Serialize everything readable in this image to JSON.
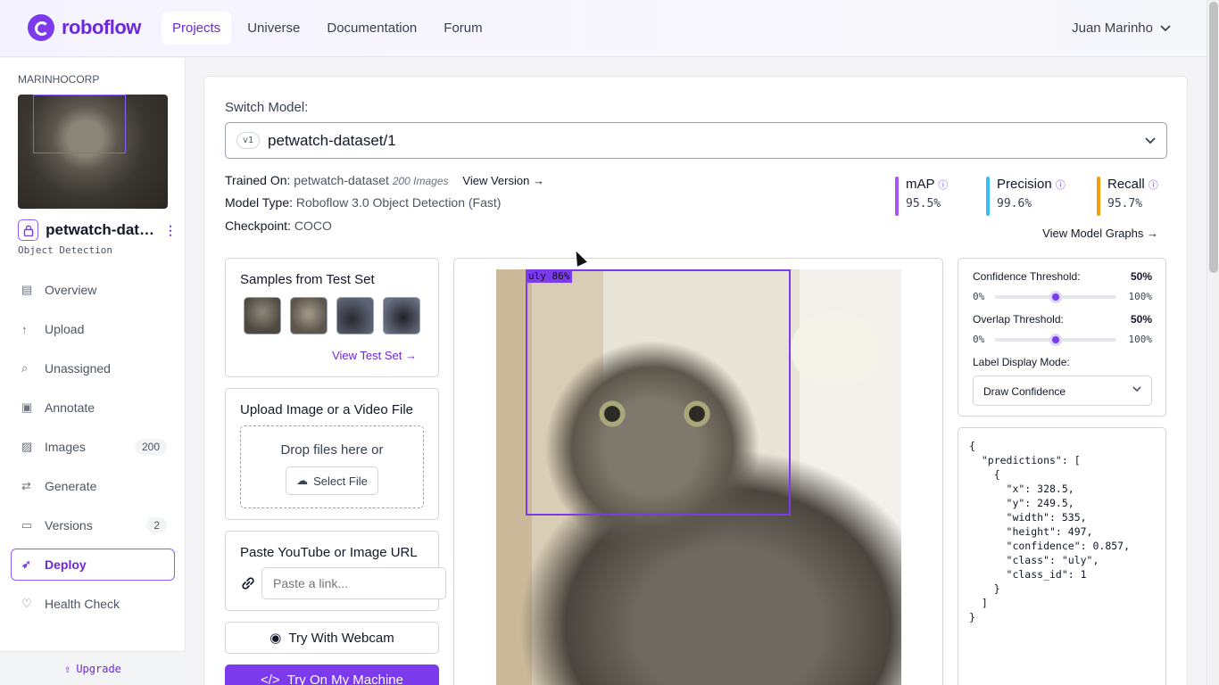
{
  "app": {
    "brand": "roboflow",
    "accent": "#7c3aed"
  },
  "topnav": {
    "items": [
      {
        "label": "Projects",
        "active": true
      },
      {
        "label": "Universe"
      },
      {
        "label": "Documentation"
      },
      {
        "label": "Forum"
      }
    ],
    "user": "Juan Marinho"
  },
  "sidebar": {
    "workspace": "MARINHOCORP",
    "project_name": "petwatch-datas...",
    "project_type": "Object Detection",
    "items": [
      {
        "label": "Overview",
        "icon": "overview-icon"
      },
      {
        "label": "Upload",
        "icon": "upload-icon"
      },
      {
        "label": "Unassigned",
        "icon": "search-icon"
      },
      {
        "label": "Annotate",
        "icon": "annotate-icon"
      },
      {
        "label": "Images",
        "icon": "images-icon",
        "badge": "200"
      },
      {
        "label": "Generate",
        "icon": "generate-icon"
      },
      {
        "label": "Versions",
        "icon": "versions-icon",
        "badge": "2"
      },
      {
        "label": "Deploy",
        "icon": "deploy-icon",
        "active": true
      },
      {
        "label": "Health Check",
        "icon": "health-icon"
      }
    ],
    "upgrade": "Upgrade"
  },
  "model": {
    "switch_label": "Switch Model:",
    "version_badge": "v1",
    "selected": "petwatch-dataset/1",
    "trained_on_label": "Trained On:",
    "trained_on": "petwatch-dataset",
    "image_count": "200 Images",
    "view_version": "View Version →",
    "type_label": "Model Type:",
    "type": "Roboflow 3.0 Object Detection (Fast)",
    "checkpoint_label": "Checkpoint:",
    "checkpoint": "COCO"
  },
  "metrics": [
    {
      "label": "mAP",
      "value": "95.5%",
      "color": "#a855f7"
    },
    {
      "label": "Precision",
      "value": "99.6%",
      "color": "#38bdf8"
    },
    {
      "label": "Recall",
      "value": "95.7%",
      "color": "#f59e0b"
    }
  ],
  "view_model_graphs": "View Model Graphs →",
  "samples": {
    "title": "Samples from Test Set",
    "link": "View Test Set →"
  },
  "upload": {
    "title": "Upload Image or a Video File",
    "drop_text": "Drop files here or",
    "select_label": "Select File"
  },
  "url": {
    "title": "Paste YouTube or Image URL",
    "placeholder": "Paste a link..."
  },
  "buttons": {
    "webcam": "Try With Webcam",
    "machine": "Try On My Machine"
  },
  "detection": {
    "label": "uly 86%"
  },
  "settings": {
    "confidence_label": "Confidence Threshold:",
    "confidence_value": "50%",
    "overlap_label": "Overlap Threshold:",
    "overlap_value": "50%",
    "slider_min": "0%",
    "slider_max": "100%",
    "label_mode_label": "Label Display Mode:",
    "label_mode_value": "Draw Confidence"
  },
  "json_output": "{\n  \"predictions\": [\n    {\n      \"x\": 328.5,\n      \"y\": 249.5,\n      \"width\": 535,\n      \"height\": 497,\n      \"confidence\": 0.857,\n      \"class\": \"uly\",\n      \"class_id\": 1\n    }\n  ]\n}"
}
